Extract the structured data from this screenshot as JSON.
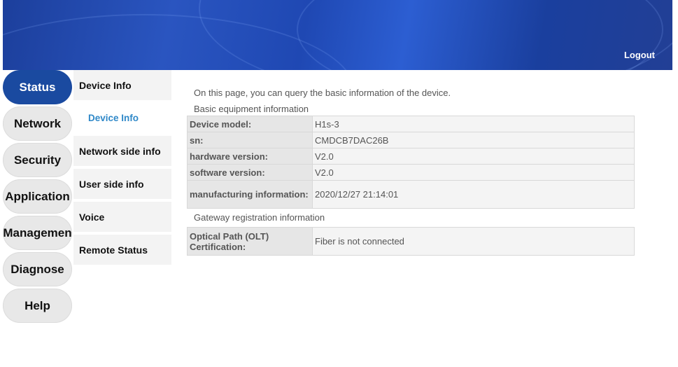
{
  "header": {
    "logout_label": "Logout"
  },
  "left_nav": [
    {
      "label": "Status",
      "active": true
    },
    {
      "label": "Network",
      "active": false
    },
    {
      "label": "Security",
      "active": false
    },
    {
      "label": "Application",
      "active": false
    },
    {
      "label": "Managemen",
      "active": false
    },
    {
      "label": "Diagnose",
      "active": false
    },
    {
      "label": "Help",
      "active": false
    }
  ],
  "sub_nav": {
    "device_info": "Device Info",
    "device_info_sub": "Device Info",
    "network_side_info": "Network side info",
    "user_side_info": "User side info",
    "voice": "Voice",
    "remote_status": "Remote Status"
  },
  "content": {
    "intro": "On this page, you can query the basic information of the device.",
    "basic_title": "Basic equipment information",
    "basic_rows": [
      {
        "label": "Device model:",
        "value": "H1s-3"
      },
      {
        "label": "sn:",
        "value": "CMDCB7DAC26B"
      },
      {
        "label": "hardware version:",
        "value": "V2.0"
      },
      {
        "label": "software version:",
        "value": "V2.0"
      },
      {
        "label": "manufacturing information:",
        "value": "2020/12/27 21:14:01"
      }
    ],
    "gateway_title": "Gateway registration information",
    "gateway_rows": [
      {
        "label": "Optical Path (OLT) Certification:",
        "value": "Fiber is not connected"
      }
    ]
  },
  "colors": {
    "header_blue": "#1f48b3",
    "active_nav": "#1a4aa0",
    "sub_active_text": "#2f88c8"
  }
}
